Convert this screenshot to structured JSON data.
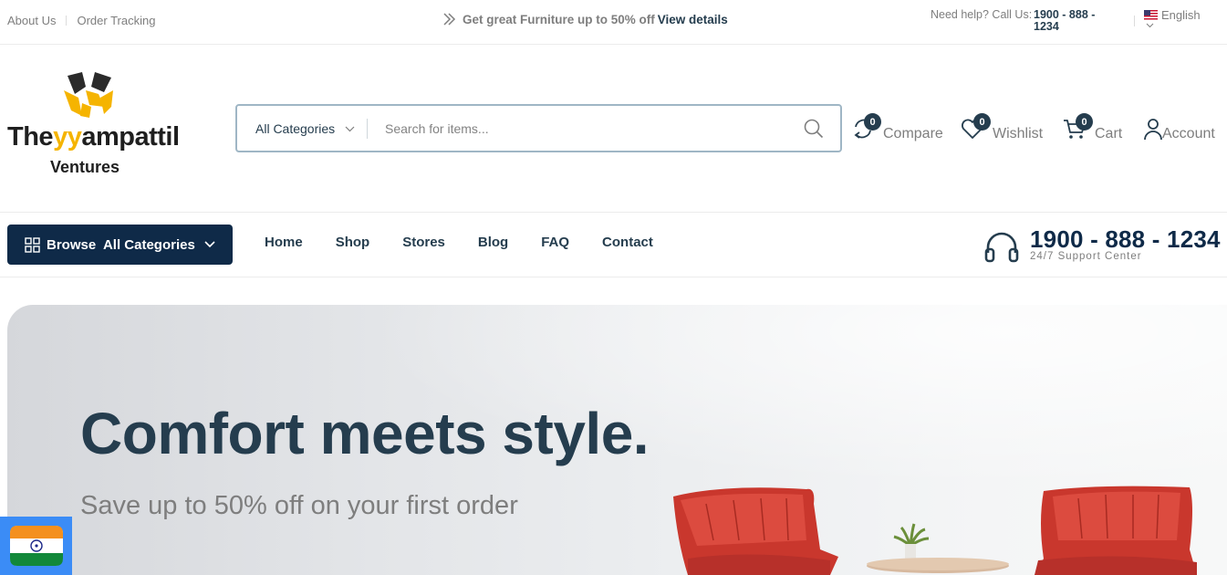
{
  "topbar": {
    "links": [
      "About Us",
      "Order Tracking"
    ],
    "promo_text": "Get great Furniture up to 50% off",
    "promo_link": "View details",
    "help_label": "Need help? Call Us:",
    "help_phone": "1900 - 888 - 1234",
    "language": "English"
  },
  "header": {
    "logo": {
      "name_pre": "The",
      "name_yy": "yy",
      "name_post": "ampattil",
      "sub": "Ventures"
    },
    "search": {
      "category": "All Categories",
      "placeholder": "Search for items..."
    },
    "actions": [
      {
        "label": "Compare",
        "count": "0",
        "icon": "compare-icon"
      },
      {
        "label": "Wishlist",
        "count": "0",
        "icon": "heart-icon"
      },
      {
        "label": "Cart",
        "count": "0",
        "icon": "cart-icon"
      },
      {
        "label": "Account",
        "icon": "user-icon"
      }
    ]
  },
  "nav": {
    "browse_label": "Browse  All Categories",
    "menu": [
      "Home",
      "Shop",
      "Stores",
      "Blog",
      "FAQ",
      "Contact"
    ],
    "support_phone": "1900 - 888 - 1234",
    "support_label": "24/7 Support Center"
  },
  "hero": {
    "title": "Comfort meets style.",
    "subtitle": "Save up to 50% off on your first order"
  },
  "colors": {
    "primary": "#0f2a48",
    "text": "#253d4e",
    "muted": "#7e7e7e",
    "accent": "#f5b400",
    "chair": "#d9443a"
  }
}
